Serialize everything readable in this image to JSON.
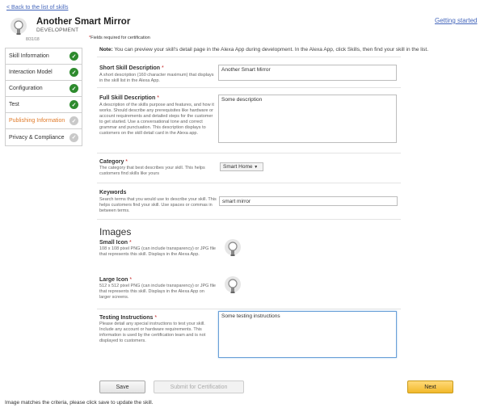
{
  "header": {
    "back_link": "< Back to the list of skills",
    "getting_started": "Getting started",
    "skill_name": "Another Smart Mirror",
    "stage": "DEVELOPMENT",
    "date": "8/31/18",
    "required_note_star": "*",
    "required_note": "Fields required for certification"
  },
  "sidebar": {
    "items": [
      {
        "label": "Skill Information",
        "status": "done"
      },
      {
        "label": "Interaction Model",
        "status": "done"
      },
      {
        "label": "Configuration",
        "status": "done"
      },
      {
        "label": "Test",
        "status": "done"
      },
      {
        "label": "Publishing Information",
        "status": "todo"
      },
      {
        "label": "Privacy & Compliance",
        "status": "todo"
      }
    ]
  },
  "note": {
    "prefix": "Note:",
    "text": "You can preview your skill's detail page in the Alexa App during development. In the Alexa App, click Skills, then find your skill in the list."
  },
  "fields": {
    "short_desc": {
      "label": "Short Skill Description",
      "star": "*",
      "desc": "A short description (160 character maximum) that displays in the skill list in the Alexa App.",
      "value": "Another Smart Mirror"
    },
    "full_desc": {
      "label": "Full Skill Description",
      "star": "*",
      "desc": "A description of the skills purpose and features, and how it works. Should describe any prerequisites like hardware or account requirements and detailed steps for the customer to get started. Use a conversational tone and correct grammar and punctuation. This description displays to customers on the skill detail card in the Alexa app.",
      "value": "Some description"
    },
    "category": {
      "label": "Category",
      "star": "*",
      "desc": "The category that best describes your skill. This helps customers find skills like yours",
      "value": "Smart Home",
      "arrow": "▼"
    },
    "keywords": {
      "label": "Keywords",
      "desc": "Search terms that you would use to describe your skill. This helps customers find your skill. Use spaces or commas in between terms.",
      "value": "smart mirror"
    },
    "images_title": "Images",
    "small_icon": {
      "label": "Small Icon",
      "star": "*",
      "desc": "108 x 108 pixel PNG (can include transparency) or JPG file that represents this skill. Displays in the Alexa App."
    },
    "large_icon": {
      "label": "Large Icon",
      "star": "*",
      "desc": "512 x 512 pixel PNG (can include transparency) or JPG file that represents this skill. Displays in the Alexa App on larger screens."
    },
    "testing": {
      "label": "Testing Instructions",
      "star": "*",
      "desc": "Please detail any special instructions to test your skill. Include any account or hardware requirements. This information is used by the certification team and is not displayed to customers.",
      "value": "Some testing instructions"
    }
  },
  "buttons": {
    "save": "Save",
    "submit": "Submit for Certification",
    "next": "Next"
  },
  "status_message": "Image matches the criteria, please click save to update the skill.",
  "colors": {
    "done_check": "#2e8b2e",
    "todo_check": "#c9c9c9",
    "active_sidebar": "#e07b2a",
    "next_button": "#f2b92b",
    "required_star": "#c62828"
  }
}
